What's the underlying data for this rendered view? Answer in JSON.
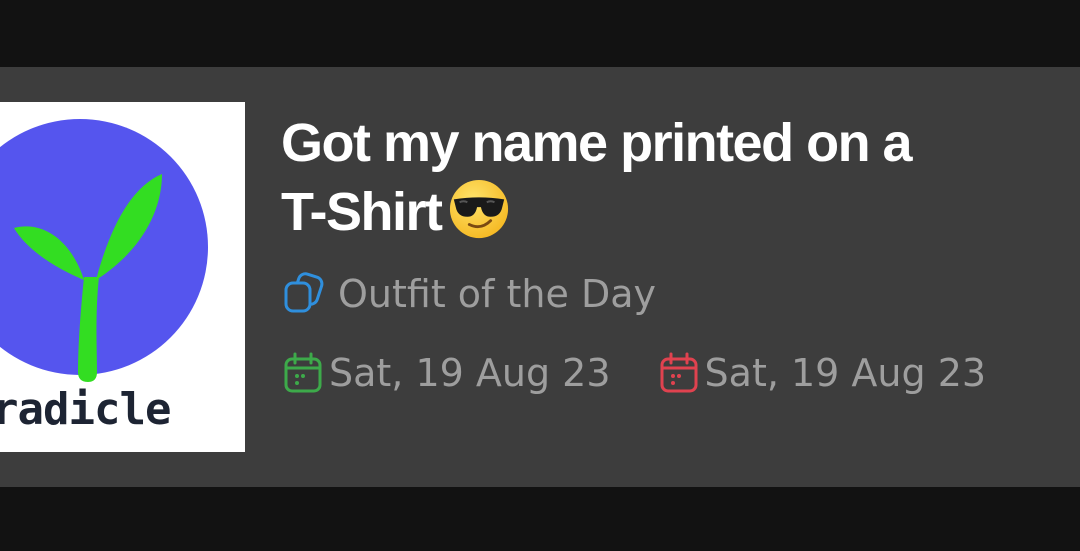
{
  "post": {
    "title_line1": "Got my name printed on a",
    "title_line2": "T-Shirt",
    "title_emoji": "smiling-face-with-sunglasses",
    "thumbnail": {
      "logo_text": "radicle",
      "circle_color": "#5555ee",
      "sprout_color": "#33dd22"
    },
    "category": {
      "icon": "documents-icon",
      "label": "Outfit of the Day",
      "icon_color": "#2f8fdd"
    },
    "dates": [
      {
        "icon": "calendar-icon",
        "label": "Sat, 19 Aug 23",
        "icon_color": "#3daa4a"
      },
      {
        "icon": "calendar-icon",
        "label": "Sat, 19 Aug 23",
        "icon_color": "#e0424f"
      }
    ]
  }
}
